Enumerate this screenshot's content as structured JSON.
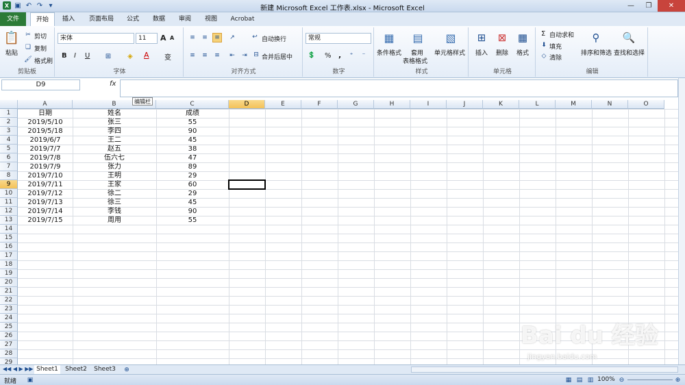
{
  "window": {
    "title": "新建 Microsoft Excel 工作表.xlsx - Microsoft Excel"
  },
  "tabs": [
    "文件",
    "开始",
    "插入",
    "页面布局",
    "公式",
    "数据",
    "审阅",
    "视图",
    "Acrobat"
  ],
  "ribbon": {
    "clipboard": {
      "paste": "粘贴",
      "cut": "剪切",
      "copy": "复制",
      "format_painter": "格式刷",
      "label": "剪贴板"
    },
    "font": {
      "name": "宋体",
      "size": "11",
      "label": "字体",
      "bold": "B",
      "italic": "I",
      "underline": "U",
      "grow": "A",
      "shrink": "A",
      "color_a": "A",
      "wen": "变"
    },
    "align": {
      "wrap": "自动换行",
      "merge": "合并后居中",
      "label": "对齐方式"
    },
    "number": {
      "format": "常规",
      "label": "数字",
      "percent": "%",
      "comma": ","
    },
    "styles": {
      "cond": "条件格式",
      "table1": "套用",
      "table2": "表格格式",
      "cell": "单元格样式",
      "label": "样式"
    },
    "cells": {
      "insert": "插入",
      "delete": "删除",
      "format": "格式",
      "label": "单元格"
    },
    "edit": {
      "autosum": "自动求和",
      "fill": "填充",
      "clear": "清除",
      "sort": "排序和筛选",
      "find": "查找和选择",
      "label": "编辑"
    }
  },
  "formula_bar": {
    "name_box": "D9",
    "fx": "fx",
    "tooltip": "编辑栏"
  },
  "columns": [
    "A",
    "B",
    "C",
    "D",
    "E",
    "F",
    "G",
    "H",
    "I",
    "J",
    "K",
    "L",
    "M",
    "N",
    "O"
  ],
  "rows": [
    "1",
    "2",
    "3",
    "4",
    "5",
    "6",
    "7",
    "8",
    "9",
    "10",
    "11",
    "12",
    "13",
    "14",
    "15",
    "16",
    "17",
    "18",
    "19",
    "20",
    "21",
    "22",
    "23",
    "24",
    "25",
    "26",
    "27",
    "28",
    "29"
  ],
  "table": {
    "headers": [
      "日期",
      "姓名",
      "成绩"
    ],
    "data": [
      [
        "2019/5/10",
        "张三",
        "55"
      ],
      [
        "2019/5/18",
        "李四",
        "90"
      ],
      [
        "2019/6/7",
        "王二",
        "45"
      ],
      [
        "2019/7/7",
        "赵五",
        "38"
      ],
      [
        "2019/7/8",
        "伍六七",
        "47"
      ],
      [
        "2019/7/9",
        "张力",
        "89"
      ],
      [
        "2019/7/10",
        "王明",
        "29"
      ],
      [
        "2019/7/11",
        "王家",
        "60"
      ],
      [
        "2019/7/12",
        "徐二",
        "29"
      ],
      [
        "2019/7/13",
        "徐三",
        "45"
      ],
      [
        "2019/7/14",
        "李钱",
        "90"
      ],
      [
        "2019/7/15",
        "周用",
        "55"
      ]
    ]
  },
  "sheets": [
    "Sheet1",
    "Sheet2",
    "Sheet3"
  ],
  "status": {
    "ready": "就绪",
    "zoom": "100%"
  },
  "watermark": {
    "main": "Bai du 经验",
    "sub": "jingyan.baidu.com"
  }
}
